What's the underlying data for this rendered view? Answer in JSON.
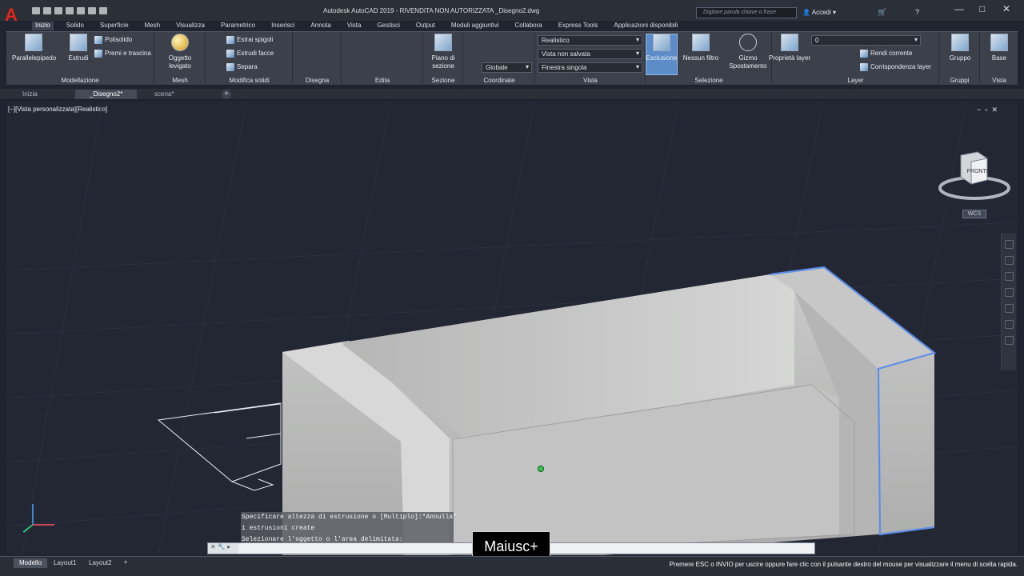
{
  "window": {
    "title": "Autodesk AutoCAD 2019 - RIVENDITA NON AUTORIZZATA    _Disegno2.dwg",
    "search_placeholder": "Digitare parola chiave o frase",
    "user": "Accedi",
    "minimize": "—",
    "maximize": "□",
    "close": "✕"
  },
  "ribbon_tabs": [
    "Inizio",
    "Solido",
    "Superficie",
    "Mesh",
    "Visualizza",
    "Parametrico",
    "Inserisci",
    "Annota",
    "Vista",
    "Gestisci",
    "Output",
    "Moduli aggiuntivi",
    "Collabora",
    "Express Tools",
    "Applicazioni disponibili"
  ],
  "ribbon": {
    "modellazione": {
      "title": "Modellazione",
      "parallelepipedo": "Parallelepipedo",
      "estrudi": "Estrudi",
      "polisolido": "Polisolido",
      "premi_e_trascina": "Premi e trascina"
    },
    "mesh": {
      "title": "Mesh",
      "oggetto": "Oggetto levigato"
    },
    "modifica_solidi": {
      "title": "Modifica solidi",
      "estrai_spigoli": "Estrai spigoli",
      "estrudi_facce": "Estrudi facce",
      "separa": "Separa"
    },
    "disegna": {
      "title": "Disegna"
    },
    "edita": {
      "title": "Edita"
    },
    "sezione": {
      "title": "Sezione",
      "piano": "Piano di sezione"
    },
    "coordinate": {
      "title": "Coordinate",
      "globale": "Globale"
    },
    "vista": {
      "title": "Vista",
      "stile": "Realistico",
      "vista_non_salvata": "Vista non salvata",
      "finestra": "Finestra singola"
    },
    "selezione": {
      "title": "Selezione",
      "esclusione": "Esclusione",
      "nessun_filtro": "Nessun filtro",
      "gizmo": "Gizmo Spostamento"
    },
    "layer": {
      "title": "Layer",
      "proprieta": "Proprietà layer",
      "layer_value": "0",
      "rendi_corrente": "Rendi corrente",
      "corrispondenza": "Corrispondenza layer"
    },
    "gruppi": {
      "title": "Gruppi",
      "gruppo": "Gruppo"
    },
    "vista2": {
      "title": "Vista",
      "base": "Base"
    }
  },
  "file_tabs": [
    "Inizia",
    "_Disegno2*",
    "scena*"
  ],
  "viewport": {
    "label": "[−][Vista personalizzata][Realistico]",
    "viewcube_face": "FRONTE",
    "wcs": "WCS"
  },
  "command_history": [
    "Specificare altezza di estrusione o [Multiplo]:*Annulla*",
    "1 estrusioni create",
    "Selezionare l'oggetto o l'area delimitata:"
  ],
  "key_overlay": "Maiusc+",
  "status_tabs": [
    "Modello",
    "Layout1",
    "Layout2"
  ],
  "status_message": "Premere ESC o INVIO per uscire oppure fare clic con il pulsante destro del mouse per visualizzare il menu di scelta rapida.",
  "colors": {
    "background": "#1f2430",
    "ribbon": "#3b404b",
    "viewport": "#222733",
    "selection": "#5c8dc8",
    "sofa": "#b8b9b8"
  }
}
